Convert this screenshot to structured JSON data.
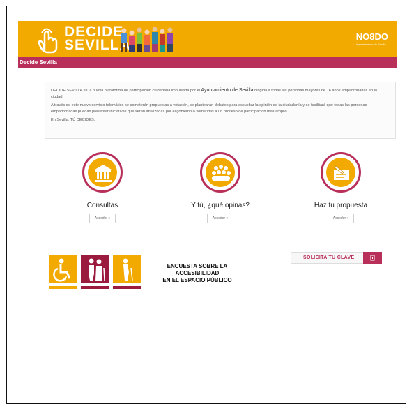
{
  "header": {
    "logo_line1": "DECIDE",
    "logo_line2": "SEVILLA",
    "partner_logo": "NO8DO",
    "partner_sub": "Ayuntamiento de Sevilla",
    "breadcrumb": "Decide Sevilla"
  },
  "intro": {
    "p1_start": "DECIDE SEVILLA es la nueva plataforma de participación ciudadana impulsada por el ",
    "p1_highlight": "Ayuntamiento de Sevilla",
    "p1_end": " dirigida a todas las personas mayores de 16 años empadronadas en la ciudad.",
    "p2": "A través de este nuevo servicio telemático se someterán propuestas a votación, se plantearán debates para escuchar la opinión de la ciudadanía y se facilitará que todas las personas empadronadas puedan presentar iniciativas que serán analizadas por el gobierno o sometidas a un proceso de participación más amplio.",
    "p3": "En Sevilla, TÚ DECIDES."
  },
  "features": [
    {
      "label": "Consultas",
      "button": "Acceder »",
      "icon": "building-icon"
    },
    {
      "label": "Y tú, ¿qué opinas?",
      "button": "Acceder »",
      "icon": "people-icon"
    },
    {
      "label": "Haz tu propuesta",
      "button": "Acceder »",
      "icon": "proposal-icon"
    }
  ],
  "survey": {
    "line1": "ENCUESTA SOBRE LA",
    "line2": "ACCESIBILIDAD",
    "line3": "EN EL ESPACIO PÚBLICO"
  },
  "clave_button": "SOLICITA TU CLAVE",
  "colors": {
    "brand_yellow": "#f2a900",
    "brand_crimson": "#b8305a"
  }
}
